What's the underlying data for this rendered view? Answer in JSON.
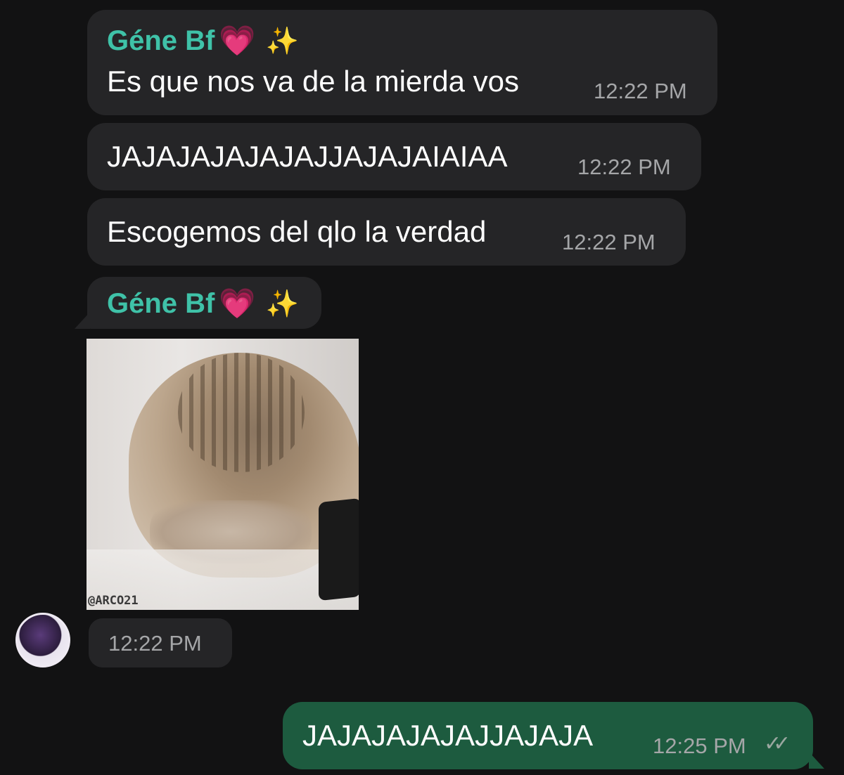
{
  "contact": {
    "name": "Géne Bf",
    "heart": "💗",
    "sparkles": "✨"
  },
  "messages": [
    {
      "text": "Es que nos va de la mierda vos",
      "time": "12:22 PM"
    },
    {
      "text": "JAJAJAJAJAJAJJAJAJAIAIAA",
      "time": "12:22 PM"
    },
    {
      "text": "Escogemos del qlo la verdad",
      "time": "12:22 PM"
    },
    {
      "media_watermark": "@ARCO21",
      "time": "12:22 PM"
    }
  ],
  "outgoing": [
    {
      "text": "JAJAJAJAJAJJAJAJA",
      "time": "12:25 PM",
      "status": "read",
      "status_icon": "double-check-icon",
      "status_glyph": "✓✓"
    }
  ],
  "colors": {
    "background": "#121213",
    "incoming_bubble": "#252527",
    "outgoing_bubble": "#1d5b3f",
    "sender_name": "#3fc2a8",
    "timestamp": "#a5a6a8"
  }
}
